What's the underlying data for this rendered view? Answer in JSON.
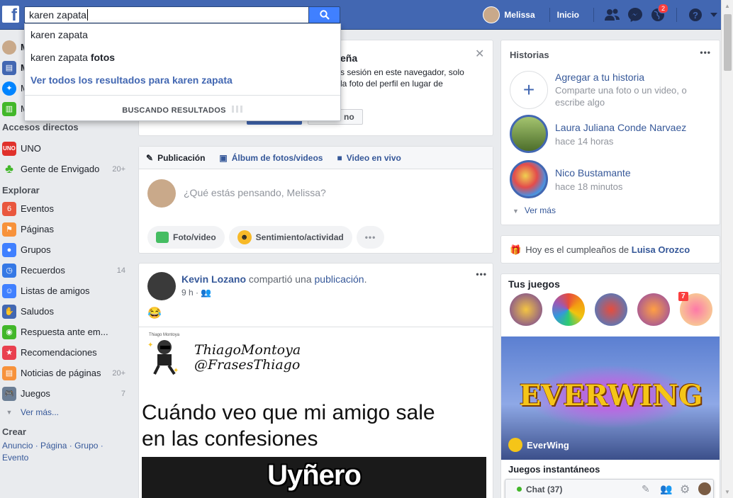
{
  "topbar": {
    "search_value": "karen zapata",
    "user_name": "Melissa",
    "home_label": "Inicio",
    "notif_count": "2"
  },
  "search_suggestions": {
    "item1": "karen zapata",
    "item2_prefix": "karen zapata ",
    "item2_bold": "fotos",
    "see_all": "Ver todos los resultados para karen zapata",
    "searching": "BUSCANDO RESULTADOS"
  },
  "leftnav": {
    "top_items": [
      {
        "label": "M"
      },
      {
        "label": "M"
      },
      {
        "label": "M"
      }
    ],
    "shortcuts_heading": "Accesos directos",
    "shortcuts": [
      {
        "label": "UNO",
        "count": ""
      },
      {
        "label": "Gente de Envigado",
        "count": "20+"
      }
    ],
    "explore_heading": "Explorar",
    "explore": [
      {
        "label": "Eventos",
        "count": "",
        "icon": "calendar-icon",
        "color": "#e9573e",
        "glyph": "6"
      },
      {
        "label": "Páginas",
        "count": "",
        "icon": "flag-icon",
        "color": "#f7923b",
        "glyph": "⚑"
      },
      {
        "label": "Grupos",
        "count": "",
        "icon": "groups-icon",
        "color": "#4080ff",
        "glyph": "●"
      },
      {
        "label": "Recuerdos",
        "count": "14",
        "icon": "memories-icon",
        "color": "#3578e5",
        "glyph": "◷"
      },
      {
        "label": "Listas de amigos",
        "count": "",
        "icon": "friend-lists-icon",
        "color": "#4080ff",
        "glyph": "☺"
      },
      {
        "label": "Saludos",
        "count": "",
        "icon": "poke-icon",
        "color": "#4267b2",
        "glyph": "✋"
      },
      {
        "label": "Respuesta ante em...",
        "count": "",
        "icon": "crisis-response-icon",
        "color": "#42b72a",
        "glyph": "◉"
      },
      {
        "label": "Recomendaciones",
        "count": "",
        "icon": "recommendations-icon",
        "color": "#e9404f",
        "glyph": "★"
      },
      {
        "label": "Noticias de páginas",
        "count": "20+",
        "icon": "page-feed-icon",
        "color": "#f7923b",
        "glyph": "▤"
      },
      {
        "label": "Juegos",
        "count": "7",
        "icon": "games-icon",
        "color": "#6b7e95",
        "glyph": "🎮"
      }
    ],
    "see_more": "Ver más...",
    "create_heading": "Crear",
    "create_links": [
      "Anuncio",
      "Página",
      "Grupo",
      "Evento"
    ]
  },
  "notice": {
    "title_tail": "eña",
    "line1": "s sesión en este navegador, solo",
    "line2": "la foto del perfil en lugar de",
    "btn2_tail": "no"
  },
  "composer": {
    "tab_post": "Publicación",
    "tab_album": "Álbum de fotos/videos",
    "tab_live": "Video en vivo",
    "placeholder": "¿Qué estás pensando, Melissa?",
    "btn_photo": "Foto/video",
    "btn_feeling": "Sentimiento/actividad",
    "btn_more": "•••"
  },
  "post": {
    "author": "Kevin Lozano",
    "action": " compartió una ",
    "action_link": "publicación",
    "action_end": ".",
    "time": "9 h",
    "emoji": "😂",
    "meme_handle1": "ThiagoMontoya",
    "meme_handle2": "@FrasesThiago",
    "meme_watermark": "Thiago Montoya",
    "meme_text1": "Cuándo veo que mi amigo sale",
    "meme_text2": "en las confesiones",
    "meme_caption": "Uyñero"
  },
  "stories": {
    "title": "Historias",
    "add_title": "Agregar a tu historia",
    "add_desc": "Comparte una foto o un video, o escribe algo",
    "items": [
      {
        "name": "Laura Juliana Conde Narvaez",
        "time": "hace 14 horas"
      },
      {
        "name": "Nico Bustamante",
        "time": "hace 18 minutos"
      }
    ],
    "see_more": "Ver más"
  },
  "birthday": {
    "prefix": "Hoy es el cumpleaños de ",
    "name": "Luisa Orozco"
  },
  "games": {
    "title": "Tus juegos",
    "badge": "7",
    "banner_title": "EVERWING",
    "banner_name": "EverWing",
    "instant": "Juegos instantáneos"
  },
  "chat": {
    "label": "Chat (37)"
  },
  "colors": {
    "brand": "#4267b2",
    "link": "#365899",
    "online": "#42b72a"
  }
}
